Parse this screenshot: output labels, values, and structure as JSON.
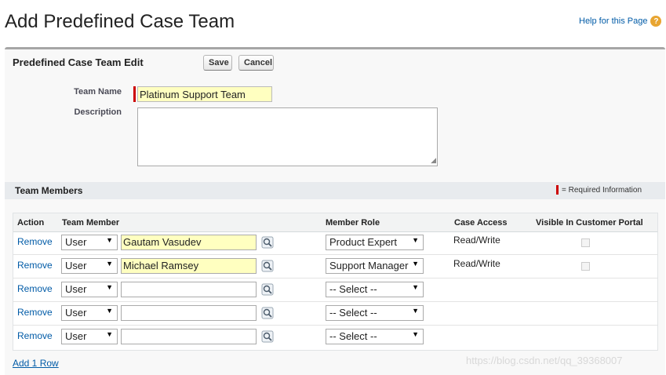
{
  "page": {
    "title": "Add Predefined Case Team",
    "help_link": "Help for this Page",
    "help_icon_glyph": "?"
  },
  "edit_panel": {
    "heading": "Predefined Case Team Edit",
    "save_label": "Save",
    "cancel_label": "Cancel",
    "team_name_label": "Team Name",
    "team_name_value": "Platinum Support Team",
    "description_label": "Description",
    "description_value": ""
  },
  "team_members": {
    "heading": "Team Members",
    "required_legend": "= Required Information",
    "columns": [
      "Action",
      "Team Member",
      "Member Role",
      "Case Access",
      "Visible In Customer Portal"
    ],
    "rows": [
      {
        "action": "Remove",
        "type": "User",
        "member": "Gautam Vasudev",
        "role": "Product Expert",
        "access": "Read/Write",
        "visible": false
      },
      {
        "action": "Remove",
        "type": "User",
        "member": "Michael Ramsey",
        "role": "Support Manager",
        "access": "Read/Write",
        "visible": false
      },
      {
        "action": "Remove",
        "type": "User",
        "member": "",
        "role": "-- Select --",
        "access": "",
        "visible": null
      },
      {
        "action": "Remove",
        "type": "User",
        "member": "",
        "role": "-- Select --",
        "access": "",
        "visible": null
      },
      {
        "action": "Remove",
        "type": "User",
        "member": "",
        "role": "-- Select --",
        "access": "",
        "visible": null
      }
    ],
    "add_row_link": "Add 1 Row"
  },
  "watermark": "https://blog.csdn.net/qq_39368007",
  "colors": {
    "link": "#015ba7",
    "required": "#cc0000",
    "highlight_field": "#ffffc0",
    "help_icon": "#e8a531"
  }
}
